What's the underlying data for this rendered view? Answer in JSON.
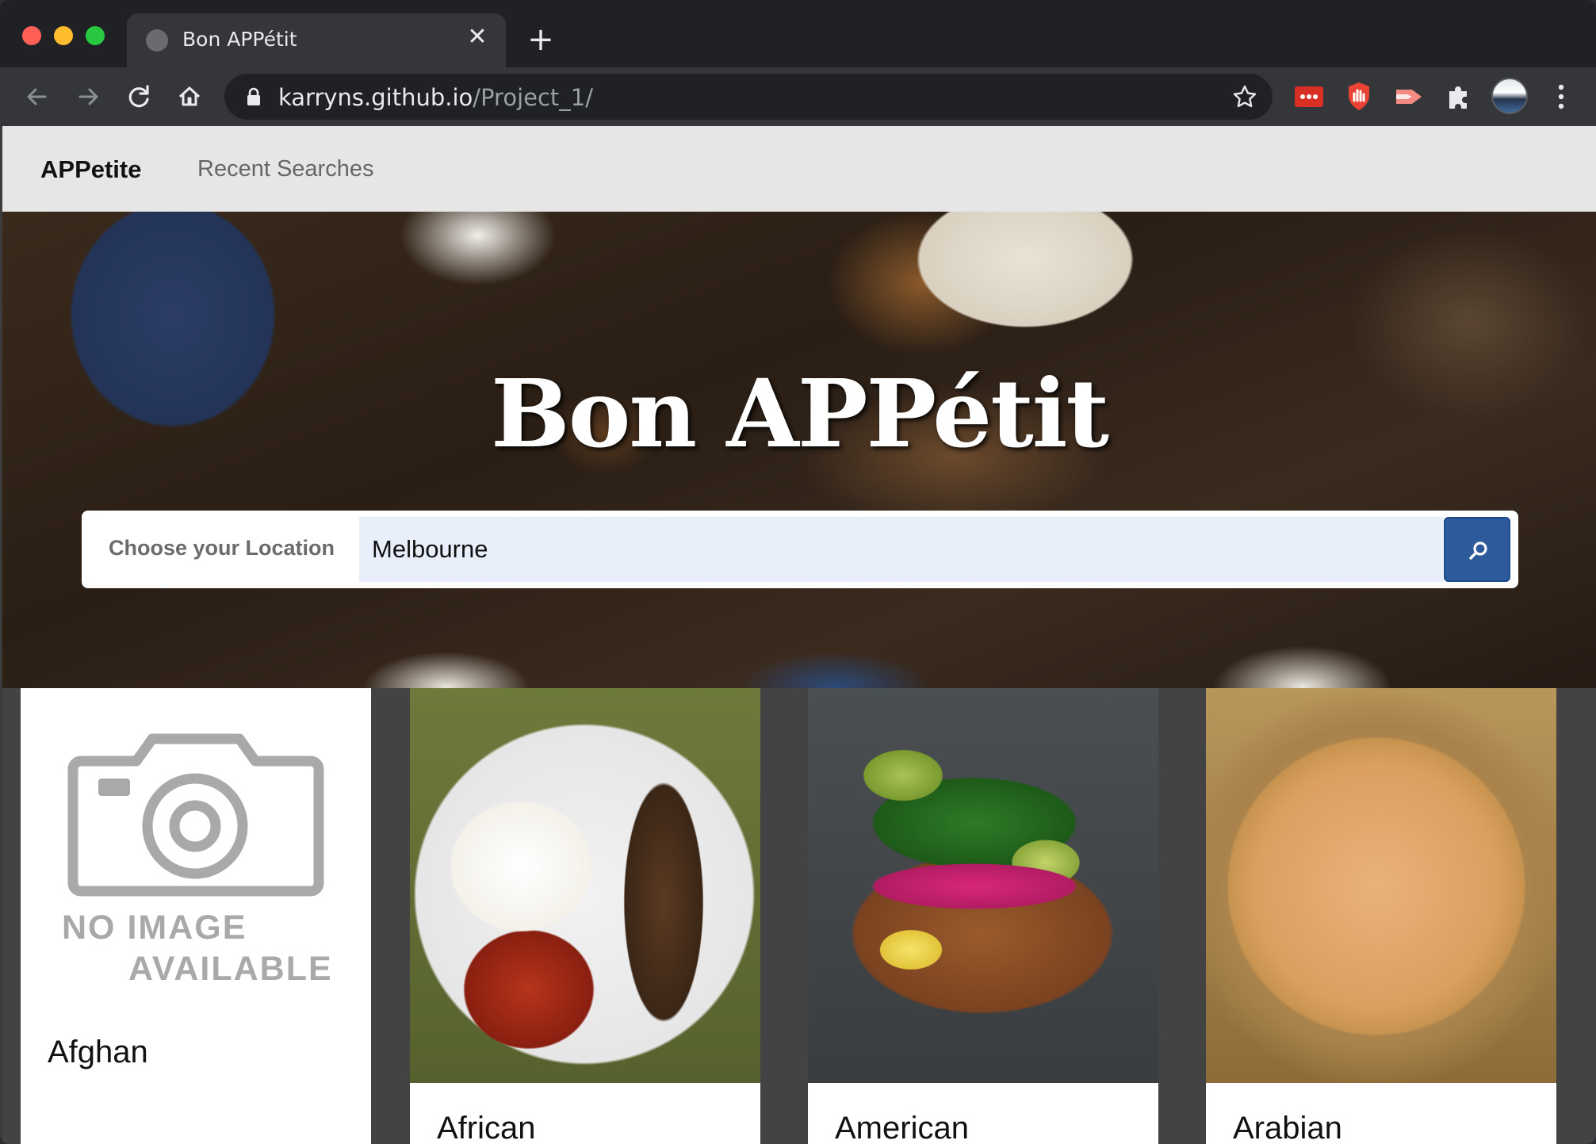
{
  "browser": {
    "tab_title": "Bon APPétit",
    "tab_close": "✕",
    "new_tab": "+",
    "url_host": "karryns.github.io",
    "url_path": "/Project_1/"
  },
  "navbar": {
    "brand": "APPetite",
    "links": [
      "Recent Searches"
    ]
  },
  "hero": {
    "title": "Bon APPétit"
  },
  "search": {
    "label": "Choose your Location",
    "value": "Melbourne"
  },
  "cards": [
    {
      "label": "Afghan",
      "image": "no-image",
      "no_image_line1": "NO IMAGE",
      "no_image_line2": "AVAILABLE"
    },
    {
      "label": "African",
      "image": "african-food-photo"
    },
    {
      "label": "American",
      "image": "american-food-photo"
    },
    {
      "label": "Arabian",
      "image": "arabian-food-photo"
    }
  ]
}
